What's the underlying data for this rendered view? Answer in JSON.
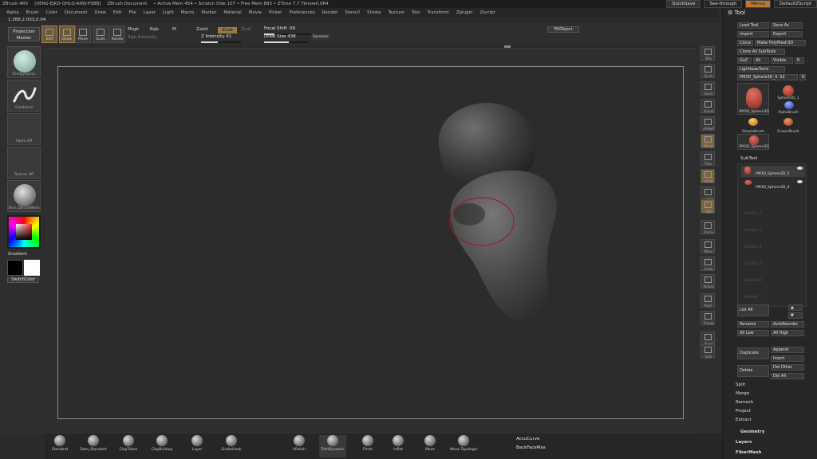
{
  "titlebar": {
    "app": "ZBrush 4R5",
    "build": "[VERG-EJKD-QHLQ-AIWJ-PSBB]",
    "document": "ZBrush Document",
    "mem": "• Active Mem 454 • Scratch Disk 107 • Free Mem 893 • ZTime 7.7 Timer▸0.064",
    "quicksave": "QuickSave",
    "seethrough": "See-through",
    "menus_btn": "Menus",
    "script": "DefaultZScript"
  },
  "menubar": [
    "Alpha",
    "Brush",
    "Color",
    "Document",
    "Draw",
    "Edit",
    "File",
    "Layer",
    "Light",
    "Macro",
    "Marker",
    "Material",
    "Movie",
    "Picker",
    "Preferences",
    "Render",
    "Stencil",
    "Stroke",
    "Texture",
    "Tool",
    "Transform",
    "Zplugin",
    "Zscript"
  ],
  "coords": "1.388,2.003,0.04",
  "toolbar": {
    "projection": "Projection\nMaster",
    "tools": [
      {
        "id": "edit",
        "label": "Edit",
        "active": true
      },
      {
        "id": "draw",
        "label": "Draw",
        "active": true
      },
      {
        "id": "move",
        "label": "Move",
        "active": false
      },
      {
        "id": "scale",
        "label": "Scale",
        "active": false
      },
      {
        "id": "rotate",
        "label": "Rotate",
        "active": false
      }
    ],
    "mrgb": "Mrgb",
    "rgb": "Rgb",
    "m": "M",
    "rgb_intensity": "Rgb Intensity",
    "zadd": "Zadd",
    "zsub": "Zsub",
    "zcut": "Zcut",
    "z_intensity": {
      "label": "Z Intensity",
      "value": "41",
      "level": 0.41
    },
    "focal_shift": {
      "label": "Focal Shift",
      "value": "-56",
      "level": 0.22
    },
    "draw_size": {
      "label": "Draw Size",
      "value": "438",
      "level": 0.55
    },
    "dynamic": "Dynamic",
    "fillobject": "FillObject"
  },
  "leftshelf": {
    "brush_caption": "TrimDynamic",
    "stroke_caption": "FreeHand",
    "alpha_caption": "Alpha Off",
    "texture_caption": "Texture Off",
    "material_caption": "Skin_ZBrushBlem",
    "gradient": "Gradient",
    "switchcolor": "SwitchColor"
  },
  "rightshelf": [
    "SPix",
    "Scroll",
    "Zoom",
    "Actual",
    "AAHalf",
    "Persp",
    "Floor",
    "Local",
    "L.Sym",
    "Xyz",
    "Frame",
    "Move",
    "Scale",
    "Rotate",
    "PolyF",
    "Transp",
    "Ghost",
    "Solo"
  ],
  "toolpanel": {
    "title": "Tool",
    "load_tool": "Load Tool",
    "save_as": "Save As",
    "import": "Import",
    "export": "Export",
    "clone": "Clone",
    "make_polymesh": "Make PolyMesh3D",
    "clone_all": "Clone All SubTools",
    "goz": "GoZ",
    "all": "All",
    "visible": "Visible",
    "r": "R",
    "lightbox_tools": "Lightbox▸Tools",
    "current_tool": "PM3D_Sphere3D_4. 52",
    "thumbs": [
      {
        "cap": "PM3D_Sphere3D"
      },
      {
        "cap": "Sphere3D_1"
      },
      {
        "cap": "AlphaBrush"
      },
      {
        "cap": "SimpleBrush"
      },
      {
        "cap": "EraserBrush"
      },
      {
        "cap": "PM3D_Sphere3D"
      }
    ],
    "subtool_header": "SubTool",
    "subtools": [
      {
        "name": "PM3D_Sphere3D_5"
      },
      {
        "name": "PM3D_Sphere3D_4"
      }
    ],
    "empty_slots": [
      "SubTool 2",
      "SubTool 3",
      "SubTool 4",
      "SubTool 5",
      "SubTool 6",
      "SubTool 7"
    ],
    "list_all": "List All",
    "rename": "Rename",
    "autoreorder": "AutoReorder",
    "all_low": "All Low",
    "all_high": "All High",
    "duplicate": "Duplicate",
    "append": "Append",
    "insert": "Insert",
    "delete": "Delete",
    "del_other": "Del Other",
    "del_all": "Del All",
    "split": "Split",
    "merge": "Merge",
    "remesh": "Remesh",
    "project": "Project",
    "extract": "Extract",
    "geometry": "Geometry",
    "layers": "Layers",
    "fibermesh": "FiberMesh"
  },
  "bottomshelf": {
    "brushes": [
      "Standard",
      "Dam_Standard",
      "ClayTubes",
      "ClayBuildup",
      "Layer",
      "SnakeHook",
      "hPolish",
      "TrimDynamic",
      "Pinch",
      "Inflat",
      "Move",
      "Move Topologic"
    ],
    "selected": "TrimDynamic",
    "accucurve": "AccuCurve",
    "backfacemask": "BackFaceMas"
  },
  "colors": {
    "accent": "#b97a2f",
    "panel": "#262626",
    "canvas": "#2c2c2c",
    "main_color": "#000000",
    "secondary_color": "#ffffff",
    "brush_ring": "#9b1f2a"
  }
}
